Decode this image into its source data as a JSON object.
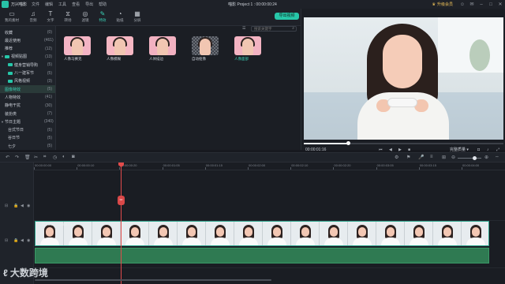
{
  "titlebar": {
    "app_name": "万兴喵影",
    "menus": [
      "文件",
      "编辑",
      "工具",
      "查看",
      "导出",
      "帮助"
    ],
    "project_title": "喵影 Project 1 : 00:00:00:24",
    "upgrade_label": "升级会员",
    "icons": [
      "user-icon",
      "message-icon",
      "minimize-icon",
      "maximize-icon",
      "close-icon"
    ]
  },
  "toolbar": {
    "tools": [
      {
        "label": "我的素材",
        "icon": "folder-icon"
      },
      {
        "label": "音频",
        "icon": "music-icon"
      },
      {
        "label": "文字",
        "icon": "text-icon"
      },
      {
        "label": "转场",
        "icon": "transition-icon"
      },
      {
        "label": "滤镜",
        "icon": "filter-icon"
      },
      {
        "label": "特效",
        "icon": "effects-icon",
        "active": true
      },
      {
        "label": "贴纸",
        "icon": "sticker-icon"
      },
      {
        "label": "分屏",
        "icon": "splitscreen-icon"
      }
    ],
    "export_label": "导出视频"
  },
  "sidebar": {
    "items": [
      {
        "label": "收藏",
        "count": "(0)",
        "level": 0
      },
      {
        "label": "最近使用",
        "count": "(461)",
        "level": 0
      },
      {
        "label": "推荐",
        "count": "(12)",
        "level": 0
      },
      {
        "label": "视频贴图",
        "count": "(13)",
        "level": 0,
        "expand": true,
        "badge": true
      },
      {
        "label": "健身营销导购",
        "count": "(5)",
        "level": 1,
        "badge": true
      },
      {
        "label": "八一建军节",
        "count": "(5)",
        "level": 1,
        "badge": true
      },
      {
        "label": "风格视频",
        "count": "(3)",
        "level": 1,
        "badge": true
      },
      {
        "label": "图像特效",
        "count": "(5)",
        "level": 0,
        "active": true
      },
      {
        "label": "人物特效",
        "count": "(41)",
        "level": 0
      },
      {
        "label": "静电干扰",
        "count": "(30)",
        "level": 0
      },
      {
        "label": "装扮类",
        "count": "(7)",
        "level": 0
      },
      {
        "label": "节日主题",
        "count": "(340)",
        "level": 0,
        "expand": true
      },
      {
        "label": "台式节日",
        "count": "(5)",
        "level": 1
      },
      {
        "label": "谷日节",
        "count": "(5)",
        "level": 1
      },
      {
        "label": "七夕",
        "count": "(5)",
        "level": 1
      }
    ]
  },
  "browser": {
    "search_placeholder": "搜索关键字",
    "items": [
      {
        "label": "人像马赛克",
        "bg": "#f3b4c4"
      },
      {
        "label": "人像模糊",
        "bg": "#f6b7c3"
      },
      {
        "label": "人体描边",
        "bg": "#f2b1c1"
      },
      {
        "label": "自动抠像",
        "bg": "checker"
      },
      {
        "label": "人像面部",
        "bg": "#f3b3c2",
        "active": true
      }
    ]
  },
  "preview": {
    "progress": 0.22,
    "timecode": "00:00:01:16",
    "quality_label": "完整质量",
    "controls": [
      "prev-frame-icon",
      "play-back-icon",
      "play-icon",
      "stop-icon"
    ],
    "right_controls": [
      "snapshot-icon",
      "volume-icon",
      "render-icon",
      "fullscreen-icon"
    ]
  },
  "timeline": {
    "ruler_ticks": [
      "00:00:00:00",
      "00:00:00:10",
      "00:00:00:20",
      "00:00:01:05",
      "00:00:01:15",
      "00:00:02:00",
      "00:00:02:10",
      "00:00:02:20",
      "00:00:03:05",
      "00:00:03:15",
      "00:00:04:00"
    ],
    "playhead_time": "00:00:01:16",
    "clip_title": "人脸 Pillow_1080p.mp4",
    "frame_count": 16,
    "colors": {
      "playhead": "#e24b4b",
      "clip": "#3d7c74",
      "audio": "#2f7a52",
      "accent": "#27c7a9"
    }
  },
  "watermark": {
    "text": "大数跨境"
  }
}
